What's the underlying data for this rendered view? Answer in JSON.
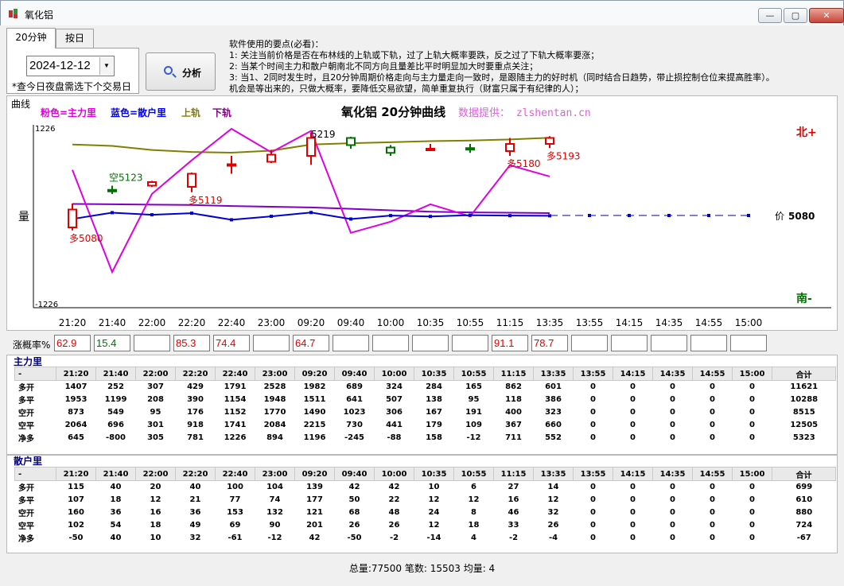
{
  "window": {
    "title": "氧化铝",
    "min_label": "—",
    "max_label": "▢",
    "close_label": "✕"
  },
  "tabs": [
    {
      "label": "20分钟"
    },
    {
      "label": "按日"
    }
  ],
  "date_picker": {
    "value": "2024-12-12",
    "arrow": "▼"
  },
  "night_note": "*查今日夜盘需选下个交易日",
  "analyze_button": {
    "label": "分析",
    "icon": "magnifier-icon"
  },
  "instructions": [
    "软件使用的要点(必看)：",
    "1: 关注当前价格是否在布林线的上轨或下轨，过了上轨大概率要跌，反之过了下轨大概率要涨；",
    "2: 当某个时间主力和散户朝南北不同方向且量差比平时明显加大时要重点关注；",
    "3: 当1、2同时发生时，且20分钟周期价格走向与主力量走向一致时，是跟随主力的好时机（同时结合日趋势，带止损控制仓位来提高胜率）。",
    "机会是等出来的，只做大概率，要降低交易欲望，简单重复执行（财富只属于有纪律的人）；"
  ],
  "chart_group_title": "曲线",
  "chart_data": {
    "type": "candlestick+line",
    "title": "氧化铝 20分钟曲线",
    "legend": [
      {
        "label": "粉色=主力里",
        "color": "#e000e0"
      },
      {
        "label": "蓝色=散户里",
        "color": "#0000ff"
      },
      {
        "label": "上轨",
        "color": "#808000"
      },
      {
        "label": "下轨",
        "color": "#800080"
      }
    ],
    "source": "数据提供： zlshentan.cn",
    "y_top_label": "1226",
    "y_bottom_label": "-1226",
    "y_axis_label": "量",
    "north_label": "北+",
    "south_label": "南-",
    "price_label": "价",
    "price_value": "5080",
    "ylim": [
      -1226,
      1226
    ],
    "categories": [
      "21:20",
      "21:40",
      "22:00",
      "22:20",
      "22:40",
      "23:00",
      "09:20",
      "09:40",
      "10:00",
      "10:35",
      "10:55",
      "11:15",
      "13:35",
      "13:55",
      "14:15",
      "14:35",
      "14:55",
      "15:00"
    ],
    "main_force_net": [
      645,
      -800,
      305,
      781,
      1226,
      894,
      1196,
      -245,
      -88,
      158,
      -12,
      711,
      552
    ],
    "retail_net": [
      -50,
      40,
      10,
      32,
      -61,
      -12,
      42,
      -50,
      -2,
      -14,
      4,
      -2,
      -4
    ],
    "upper_band": [
      880,
      860,
      800,
      770,
      760,
      790,
      880,
      900,
      915,
      930,
      940,
      955,
      980
    ],
    "lower_band": [
      130,
      125,
      120,
      115,
      100,
      90,
      80,
      60,
      40,
      20,
      10,
      5,
      0
    ],
    "candles": [
      {
        "o": 5090,
        "c": 5060,
        "h": 5100,
        "l": 5055,
        "up": false
      },
      {
        "o": 5123,
        "c": 5123,
        "h": 5130,
        "l": 5116,
        "up": true
      },
      {
        "o": 5130,
        "c": 5136,
        "h": 5138,
        "l": 5128,
        "up": false
      },
      {
        "o": 5128,
        "c": 5150,
        "h": 5152,
        "l": 5119,
        "up": false
      },
      {
        "o": 5166,
        "c": 5166,
        "h": 5180,
        "l": 5150,
        "up": false
      },
      {
        "o": 5170,
        "c": 5182,
        "h": 5190,
        "l": 5168,
        "up": false
      },
      {
        "o": 5180,
        "c": 5210,
        "h": 5219,
        "l": 5165,
        "up": false
      },
      {
        "o": 5210,
        "c": 5198,
        "h": 5212,
        "l": 5192,
        "up": true
      },
      {
        "o": 5194,
        "c": 5185,
        "h": 5198,
        "l": 5180,
        "up": true
      },
      {
        "o": 5192,
        "c": 5190,
        "h": 5200,
        "l": 5188,
        "up": false
      },
      {
        "o": 5193,
        "c": 5191,
        "h": 5200,
        "l": 5185,
        "up": true
      },
      {
        "o": 5188,
        "c": 5200,
        "h": 5210,
        "l": 5180,
        "up": false
      },
      {
        "o": 5200,
        "c": 5210,
        "h": 5213,
        "l": 5193,
        "up": false
      }
    ],
    "annotations": [
      {
        "text": "多5080",
        "idx": 0,
        "color": "#e00000"
      },
      {
        "text": "空5123",
        "idx": 1,
        "color": "#007000"
      },
      {
        "text": "多5119",
        "idx": 3,
        "color": "#e00000"
      },
      {
        "text": "5219",
        "idx": 6,
        "color": "#000000"
      },
      {
        "text": "多5180",
        "idx": 11,
        "color": "#e00000"
      },
      {
        "text": "多5193",
        "idx": 12,
        "color": "#e00000"
      }
    ]
  },
  "rates": {
    "label": "涨概率%",
    "values": [
      "62.9",
      "15.4",
      "",
      "85.3",
      "74.4",
      "",
      "64.7",
      "",
      "",
      "",
      "",
      "91.1",
      "78.7",
      "",
      "",
      "",
      "",
      ""
    ],
    "colors": [
      "#e00000",
      "#007000",
      "#000000",
      "#e00000",
      "#e00000",
      "#000000",
      "#e00000",
      "#000000",
      "#000000",
      "#000000",
      "#000000",
      "#e00000",
      "#e00000",
      "#000000",
      "#000000",
      "#000000",
      "#000000",
      "#000000"
    ]
  },
  "main_table": {
    "title": "主力里",
    "headers": [
      "-",
      "21:20",
      "21:40",
      "22:00",
      "22:20",
      "22:40",
      "23:00",
      "09:20",
      "09:40",
      "10:00",
      "10:35",
      "10:55",
      "11:15",
      "13:35",
      "13:55",
      "14:15",
      "14:35",
      "14:55",
      "15:00",
      "合计"
    ],
    "rows": [
      [
        "多开",
        "1407",
        "252",
        "307",
        "429",
        "1791",
        "2528",
        "1982",
        "689",
        "324",
        "284",
        "165",
        "862",
        "601",
        "0",
        "0",
        "0",
        "0",
        "0",
        "11621"
      ],
      [
        "多平",
        "1953",
        "1199",
        "208",
        "390",
        "1154",
        "1948",
        "1511",
        "641",
        "507",
        "138",
        "95",
        "118",
        "386",
        "0",
        "0",
        "0",
        "0",
        "0",
        "10288"
      ],
      [
        "空开",
        "873",
        "549",
        "95",
        "176",
        "1152",
        "1770",
        "1490",
        "1023",
        "306",
        "167",
        "191",
        "400",
        "323",
        "0",
        "0",
        "0",
        "0",
        "0",
        "8515"
      ],
      [
        "空平",
        "2064",
        "696",
        "301",
        "918",
        "1741",
        "2084",
        "2215",
        "730",
        "441",
        "179",
        "109",
        "367",
        "660",
        "0",
        "0",
        "0",
        "0",
        "0",
        "12505"
      ],
      [
        "净多",
        "645",
        "-800",
        "305",
        "781",
        "1226",
        "894",
        "1196",
        "-245",
        "-88",
        "158",
        "-12",
        "711",
        "552",
        "0",
        "0",
        "0",
        "0",
        "0",
        "5323"
      ]
    ]
  },
  "retail_table": {
    "title": "散户里",
    "headers": [
      "-",
      "21:20",
      "21:40",
      "22:00",
      "22:20",
      "22:40",
      "23:00",
      "09:20",
      "09:40",
      "10:00",
      "10:35",
      "10:55",
      "11:15",
      "13:35",
      "13:55",
      "14:15",
      "14:35",
      "14:55",
      "15:00",
      "合计"
    ],
    "rows": [
      [
        "多开",
        "115",
        "40",
        "20",
        "40",
        "100",
        "104",
        "139",
        "42",
        "42",
        "10",
        "6",
        "27",
        "14",
        "0",
        "0",
        "0",
        "0",
        "0",
        "699"
      ],
      [
        "多平",
        "107",
        "18",
        "12",
        "21",
        "77",
        "74",
        "177",
        "50",
        "22",
        "12",
        "12",
        "16",
        "12",
        "0",
        "0",
        "0",
        "0",
        "0",
        "610"
      ],
      [
        "空开",
        "160",
        "36",
        "16",
        "36",
        "153",
        "132",
        "121",
        "68",
        "48",
        "24",
        "8",
        "46",
        "32",
        "0",
        "0",
        "0",
        "0",
        "0",
        "880"
      ],
      [
        "空平",
        "102",
        "54",
        "18",
        "49",
        "69",
        "90",
        "201",
        "26",
        "26",
        "12",
        "18",
        "33",
        "26",
        "0",
        "0",
        "0",
        "0",
        "0",
        "724"
      ],
      [
        "净多",
        "-50",
        "40",
        "10",
        "32",
        "-61",
        "-12",
        "42",
        "-50",
        "-2",
        "-14",
        "4",
        "-2",
        "-4",
        "0",
        "0",
        "0",
        "0",
        "0",
        "-67"
      ]
    ]
  },
  "footer": "总量:77500  笔数: 15503  均量: 4"
}
